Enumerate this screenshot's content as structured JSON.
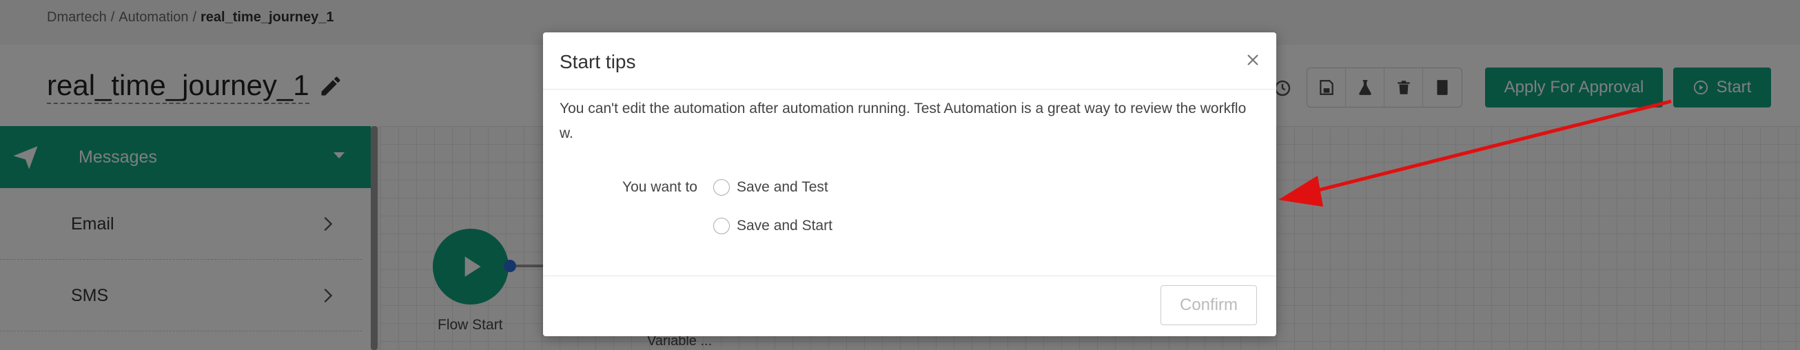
{
  "breadcrumb": {
    "items": [
      "Dmartech",
      "Automation"
    ],
    "separator": "/",
    "current": "real_time_journey_1"
  },
  "header": {
    "title": "real_time_journey_1",
    "approval_label": "Apply For Approval",
    "start_label": "Start",
    "toolbar_icons": [
      "history-icon",
      "save-icon",
      "flask-icon",
      "delete-icon",
      "book-icon"
    ]
  },
  "sidebar": {
    "section": "Messages",
    "items": [
      {
        "label": "Email"
      },
      {
        "label": "SMS"
      }
    ]
  },
  "canvas": {
    "flow_start_label": "Flow Start",
    "variable_label": "Variable ..."
  },
  "modal": {
    "title": "Start tips",
    "tip": "You can't edit the automation after automation running. Test Automation is a great way to review the workflo w.",
    "want_label": "You want to",
    "options": [
      "Save and Test",
      "Save and Start"
    ],
    "confirm_label": "Confirm"
  },
  "colors": {
    "primary": "#10a37f",
    "annotation_arrow": "#e01010",
    "node_dot": "#2b6cd6"
  }
}
